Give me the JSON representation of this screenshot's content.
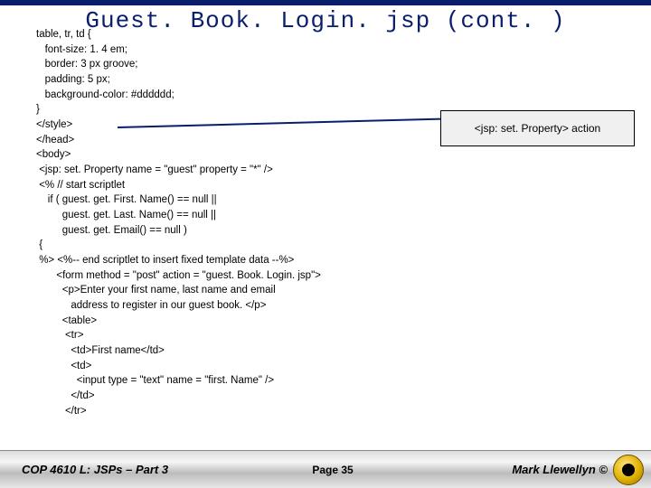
{
  "title": "Guest. Book. Login. jsp (cont. )",
  "callout": "<jsp: set. Property> action",
  "code": "table, tr, td {\n   font-size: 1. 4 em;\n   border: 3 px groove;\n   padding: 5 px;\n   background-color: #dddddd;\n}\n</style>\n</head>\n<body>\n <jsp: set. Property name = \"guest\" property = \"*\" />\n <% // start scriptlet\n    if ( guest. get. First. Name() == null ||\n         guest. get. Last. Name() == null ||\n         guest. get. Email() == null )\n {\n %> <%-- end scriptlet to insert fixed template data --%>\n       <form method = \"post\" action = \"guest. Book. Login. jsp\">\n         <p>Enter your first name, last name and email\n            address to register in our guest book. </p>\n         <table>\n          <tr>\n            <td>First name</td>\n            <td>\n              <input type = \"text\" name = \"first. Name\" />\n            </td>\n          </tr>",
  "footer": {
    "left": "COP 4610 L: JSPs – Part 3",
    "center": "Page 35",
    "right": "Mark Llewellyn ©"
  }
}
